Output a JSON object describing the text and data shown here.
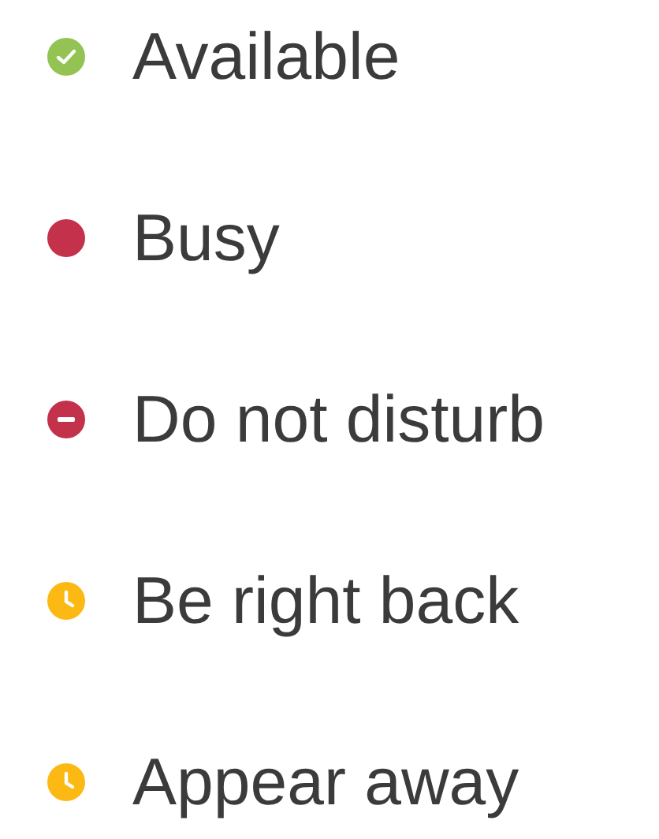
{
  "statuses": [
    {
      "label": "Available",
      "kind": "check",
      "color": "#92c353"
    },
    {
      "label": "Busy",
      "kind": "plain",
      "color": "#c4314b"
    },
    {
      "label": "Do not disturb",
      "kind": "minus",
      "color": "#c4314b"
    },
    {
      "label": "Be right back",
      "kind": "clock",
      "color": "#fdb913"
    },
    {
      "label": "Appear away",
      "kind": "clock",
      "color": "#fdb913"
    }
  ]
}
